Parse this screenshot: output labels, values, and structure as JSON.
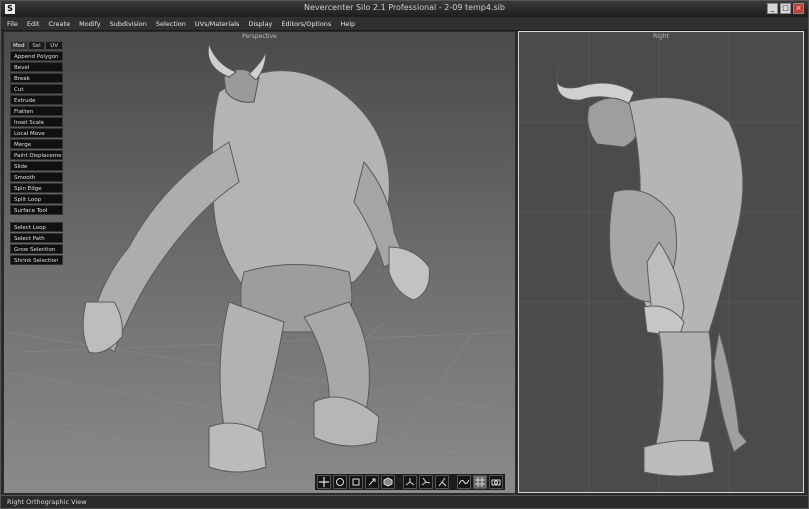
{
  "window": {
    "title": "Nevercenter Silo 2.1 Professional - 2-09 temp4.sib",
    "minimize_label": "_",
    "maximize_label": "□",
    "close_label": "×"
  },
  "menu": [
    "File",
    "Edit",
    "Create",
    "Modify",
    "Subdivision",
    "Selection",
    "UVs/Materials",
    "Display",
    "Editors/Options",
    "Help"
  ],
  "viewports": {
    "perspective_label": "Perspective",
    "right_label": "Right"
  },
  "tool_panel": {
    "tabs": [
      "Mod",
      "Sel",
      "UV"
    ],
    "active_tab": "Mod",
    "tools": [
      "Append Polygon",
      "Bevel",
      "Break",
      "Cut",
      "Extrude",
      "Flatten",
      "Inset Scale",
      "Local Move",
      "Merge",
      "Paint Displacement",
      "Slide",
      "Smooth",
      "Spin Edge",
      "Split Loop",
      "Surface Tool"
    ],
    "selection_tools": [
      "Select Loop",
      "Select Path",
      "Grow Selection",
      "Shrink Selection"
    ]
  },
  "bottom_toolbar": {
    "icons": [
      "move-tool-icon",
      "rotate-tool-icon",
      "scale-tool-icon",
      "universal-tool-icon",
      "cube-icon",
      "axis-world-icon",
      "axis-local-icon",
      "axis-screen-icon",
      "curve-icon",
      "grid-icon",
      "camera-icon"
    ],
    "active_index": 9
  },
  "status": {
    "text": "Right Orthographic View"
  },
  "colors": {
    "close_button": "#d03a2a",
    "viewport_border": "#d8d8d8",
    "tool_bg": "#101010"
  }
}
